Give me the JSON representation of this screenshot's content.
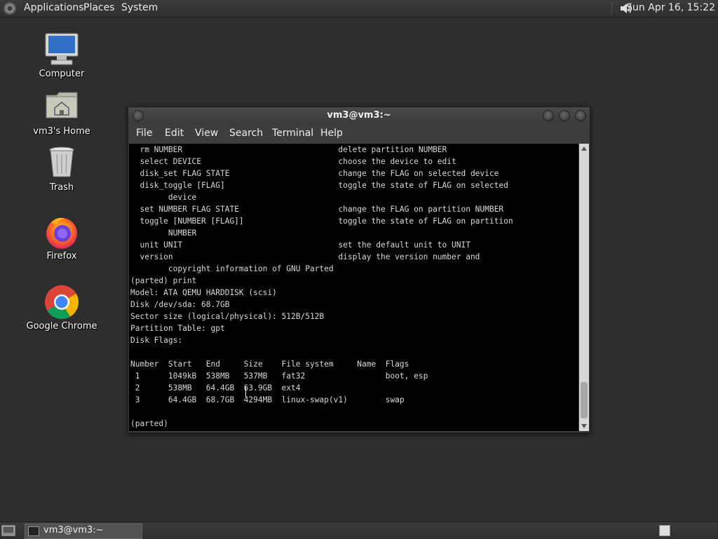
{
  "top_panel": {
    "menus": [
      "Applications",
      "Places",
      "System"
    ],
    "clock": "Sun Apr 16, 15:22"
  },
  "desktop_icons": [
    {
      "label": "Computer",
      "icon": "computer-icon"
    },
    {
      "label": "vm3's Home",
      "icon": "home-folder-icon"
    },
    {
      "label": "Trash",
      "icon": "trash-icon"
    },
    {
      "label": "Firefox",
      "icon": "firefox-icon"
    },
    {
      "label": "Google Chrome",
      "icon": "chrome-icon"
    }
  ],
  "terminal": {
    "title": "vm3@vm3:~",
    "menu": [
      "File",
      "Edit",
      "View",
      "Search",
      "Terminal",
      "Help"
    ],
    "lines": [
      "  rm NUMBER                                 delete partition NUMBER",
      "  select DEVICE                             choose the device to edit",
      "  disk_set FLAG STATE                       change the FLAG on selected device",
      "  disk_toggle [FLAG]                        toggle the state of FLAG on selected",
      "        device",
      "  set NUMBER FLAG STATE                     change the FLAG on partition NUMBER",
      "  toggle [NUMBER [FLAG]]                    toggle the state of FLAG on partition",
      "        NUMBER",
      "  unit UNIT                                 set the default unit to UNIT",
      "  version                                   display the version number and",
      "        copyright information of GNU Parted",
      "(parted) print",
      "Model: ATA QEMU HARDDISK (scsi)",
      "Disk /dev/sda: 68.7GB",
      "Sector size (logical/physical): 512B/512B",
      "Partition Table: gpt",
      "Disk Flags:",
      "",
      "Number  Start   End     Size    File system     Name  Flags",
      " 1      1049kB  538MB   537MB   fat32                 boot, esp",
      " 2      538MB   64.4GB  63.9GB  ext4",
      " 3      64.4GB  68.7GB  4294MB  linux-swap(v1)        swap",
      "",
      "(parted)"
    ]
  },
  "taskbar": {
    "window_label": "vm3@vm3:~"
  },
  "colors": {
    "desktop_bg": "#2e2e2e",
    "terminal_bg": "#000000",
    "terminal_fg": "#d8d8d8"
  }
}
